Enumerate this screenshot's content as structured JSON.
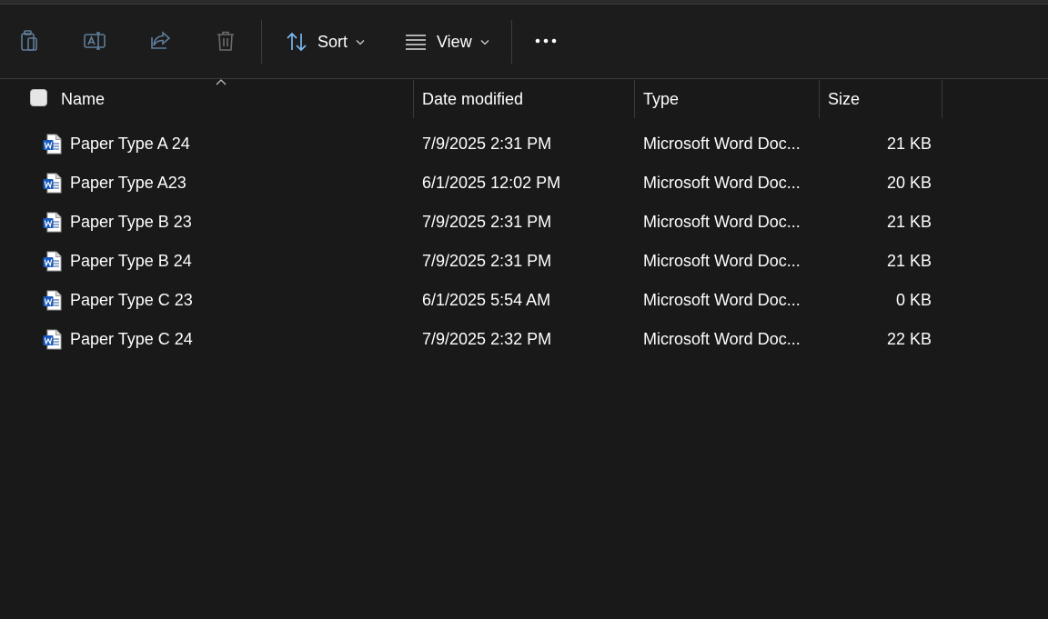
{
  "toolbar": {
    "sort_label": "Sort",
    "view_label": "View",
    "icons": [
      "clipboard-icon",
      "rename-icon",
      "share-icon",
      "trash-icon",
      "sort-icon",
      "view-lines-icon",
      "more-icon"
    ]
  },
  "columns": {
    "name": "Name",
    "date": "Date modified",
    "type": "Type",
    "size": "Size"
  },
  "files": [
    {
      "name": "Paper Type A 24",
      "date": "7/9/2025 2:31 PM",
      "type": "Microsoft Word Doc...",
      "size": "21 KB"
    },
    {
      "name": "Paper Type A23",
      "date": "6/1/2025 12:02 PM",
      "type": "Microsoft Word Doc...",
      "size": "20 KB"
    },
    {
      "name": "Paper Type B 23",
      "date": "7/9/2025 2:31 PM",
      "type": "Microsoft Word Doc...",
      "size": "21 KB"
    },
    {
      "name": "Paper Type B 24",
      "date": "7/9/2025 2:31 PM",
      "type": "Microsoft Word Doc...",
      "size": "21 KB"
    },
    {
      "name": "Paper Type C 23",
      "date": "6/1/2025 5:54 AM",
      "type": "Microsoft Word Doc...",
      "size": "0 KB"
    },
    {
      "name": "Paper Type C 24",
      "date": "7/9/2025 2:32 PM",
      "type": "Microsoft Word Doc...",
      "size": "22 KB"
    }
  ],
  "colors": {
    "background": "#191919",
    "word_blue": "#185abd",
    "disabled_icon": "#5b8fbf"
  }
}
